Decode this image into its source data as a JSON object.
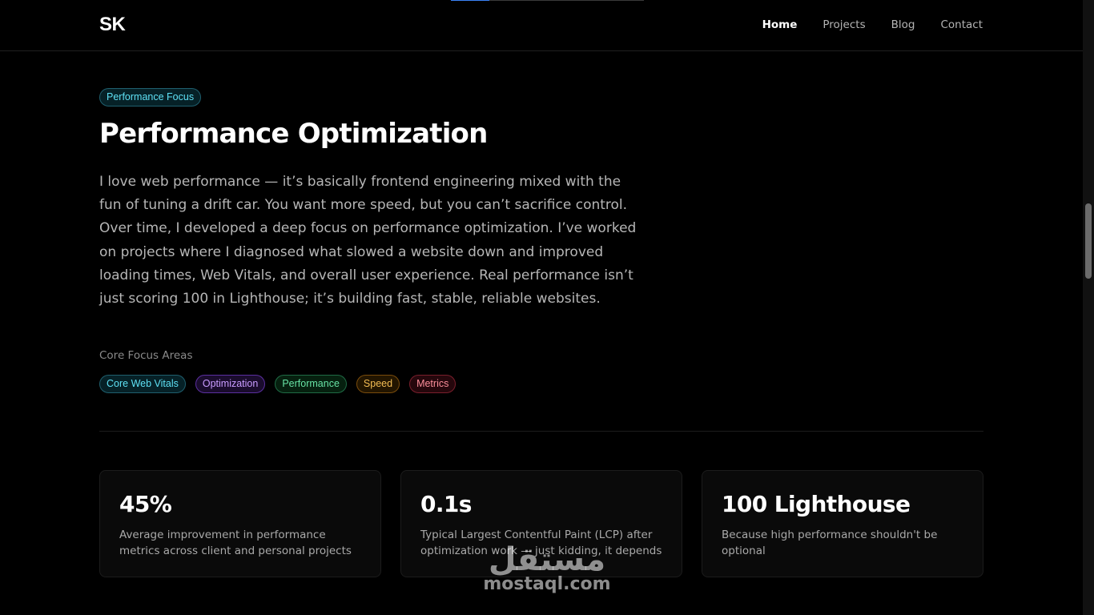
{
  "progress": {
    "fraction": 0.2,
    "accent": "#3b82f6"
  },
  "nav": {
    "logo": "SK",
    "links": [
      {
        "label": "Home",
        "active": true
      },
      {
        "label": "Projects",
        "active": false
      },
      {
        "label": "Blog",
        "active": false
      },
      {
        "label": "Contact",
        "active": false
      }
    ]
  },
  "hero": {
    "badge": "Performance Focus",
    "title": "Performance Optimization",
    "paragraph": "I love web performance — it’s basically frontend engineering mixed with the fun of tuning a drift car. You want more speed, but you can’t sacrifice control. Over time, I developed a deep focus on performance optimization. I’ve worked on projects where I diagnosed what slowed a website down and improved loading times, Web Vitals, and overall user experience. Real performance isn’t just scoring 100 in Lighthouse; it’s building fast, stable, reliable websites."
  },
  "focus": {
    "label": "Core Focus Areas",
    "tags": [
      {
        "label": "Core Web Vitals",
        "color": "cyan"
      },
      {
        "label": "Optimization",
        "color": "purple"
      },
      {
        "label": "Performance",
        "color": "green"
      },
      {
        "label": "Speed",
        "color": "amber"
      },
      {
        "label": "Metrics",
        "color": "red"
      }
    ]
  },
  "stats": [
    {
      "value": "45%",
      "description": "Average improvement in performance metrics across client and personal projects"
    },
    {
      "value": "0.1s",
      "description": "Typical Largest Contentful Paint (LCP) after optimization work — just kidding, it depends"
    },
    {
      "value": "100 Lighthouse",
      "description": "Because high performance shouldn't be optional"
    }
  ],
  "watermark": {
    "arabic": "مستقل",
    "latin": "mostaql.com"
  },
  "scroll": {
    "position_fraction": 0.33
  }
}
